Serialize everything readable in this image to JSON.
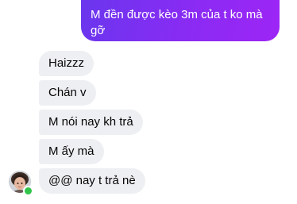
{
  "thread": {
    "outgoing": [
      {
        "text": "M đền được kèo 3m của t ko mà gỡ"
      }
    ],
    "incoming": [
      {
        "text": "Haizzz"
      },
      {
        "text": "Chán v"
      },
      {
        "text": "M nói nay kh trả"
      },
      {
        "text": "M ấy mà"
      },
      {
        "text": "@@ nay t trả nè"
      }
    ]
  },
  "contact": {
    "avatar_icon": "user-avatar",
    "status_icon": "online-status-dot",
    "status_color": "#31c44a"
  },
  "colors": {
    "outgoing_start": "#6a36ee",
    "outgoing_end": "#9d25f5",
    "incoming_bubble": "#eeeff2"
  }
}
